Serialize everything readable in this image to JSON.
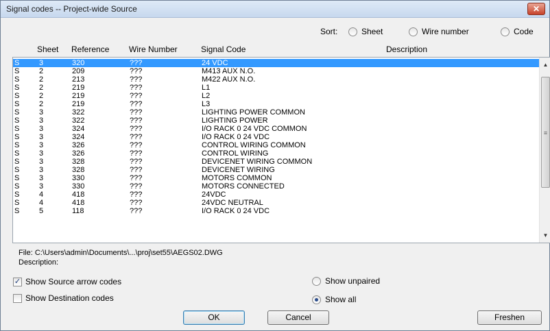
{
  "window": {
    "title": "Signal codes -- Project-wide Source",
    "close_glyph": "✕"
  },
  "sort": {
    "label": "Sort:",
    "options": [
      {
        "label": "Sheet",
        "checked": false
      },
      {
        "label": "Wire number",
        "checked": false
      },
      {
        "label": "Code",
        "checked": false
      }
    ]
  },
  "list": {
    "headers": {
      "sheet": "Sheet",
      "reference": "Reference",
      "wire_number": "Wire Number",
      "signal_code": "Signal Code",
      "description": "Description"
    },
    "rows": [
      {
        "type": "S",
        "sheet": "3",
        "reference": "320",
        "wire": "???",
        "code": "24 VDC",
        "selected": true
      },
      {
        "type": "S",
        "sheet": "2",
        "reference": "209",
        "wire": "???",
        "code": "M413 AUX N.O."
      },
      {
        "type": "S",
        "sheet": "2",
        "reference": "213",
        "wire": "???",
        "code": "M422 AUX N.O."
      },
      {
        "type": "S",
        "sheet": "2",
        "reference": "219",
        "wire": "???",
        "code": "L1"
      },
      {
        "type": "S",
        "sheet": "2",
        "reference": "219",
        "wire": "???",
        "code": "L2"
      },
      {
        "type": "S",
        "sheet": "2",
        "reference": "219",
        "wire": "???",
        "code": "L3"
      },
      {
        "type": "S",
        "sheet": "3",
        "reference": "322",
        "wire": "???",
        "code": "LIGHTING POWER COMMON"
      },
      {
        "type": "S",
        "sheet": "3",
        "reference": "322",
        "wire": "???",
        "code": "LIGHTING POWER"
      },
      {
        "type": "S",
        "sheet": "3",
        "reference": "324",
        "wire": "???",
        "code": "I/O RACK 0 24 VDC COMMON"
      },
      {
        "type": "S",
        "sheet": "3",
        "reference": "324",
        "wire": "???",
        "code": "I/O RACK 0 24 VDC"
      },
      {
        "type": "S",
        "sheet": "3",
        "reference": "326",
        "wire": "???",
        "code": "CONTROL WIRING COMMON"
      },
      {
        "type": "S",
        "sheet": "3",
        "reference": "326",
        "wire": "???",
        "code": "CONTROL WIRING"
      },
      {
        "type": "S",
        "sheet": "3",
        "reference": "328",
        "wire": "???",
        "code": "DEVICENET WIRING COMMON"
      },
      {
        "type": "S",
        "sheet": "3",
        "reference": "328",
        "wire": "???",
        "code": "DEVICENET WIRING"
      },
      {
        "type": "S",
        "sheet": "3",
        "reference": "330",
        "wire": "???",
        "code": "MOTORS COMMON"
      },
      {
        "type": "S",
        "sheet": "3",
        "reference": "330",
        "wire": "???",
        "code": "MOTORS CONNECTED"
      },
      {
        "type": "S",
        "sheet": "4",
        "reference": "418",
        "wire": "???",
        "code": "24VDC"
      },
      {
        "type": "S",
        "sheet": "4",
        "reference": "418",
        "wire": "???",
        "code": "24VDC NEUTRAL"
      },
      {
        "type": "S",
        "sheet": "5",
        "reference": "118",
        "wire": "???",
        "code": "I/O RACK 0 24 VDC"
      }
    ],
    "scroll_arrows": {
      "up": "▲",
      "down": "▼",
      "thumb_grip": "≡"
    }
  },
  "details": {
    "file": "File: C:\\Users\\admin\\Documents\\...\\proj\\set55\\AEGS02.DWG",
    "description": "Description:"
  },
  "options": {
    "show_source": {
      "label": "Show Source arrow codes",
      "checked": true,
      "mark": "✓"
    },
    "show_destination": {
      "label": "Show Destination codes",
      "checked": false
    },
    "show_unpaired": {
      "label": "Show unpaired",
      "checked": false
    },
    "show_all": {
      "label": "Show all",
      "checked": true
    }
  },
  "buttons": {
    "ok": "OK",
    "cancel": "Cancel",
    "freshen": "Freshen"
  }
}
